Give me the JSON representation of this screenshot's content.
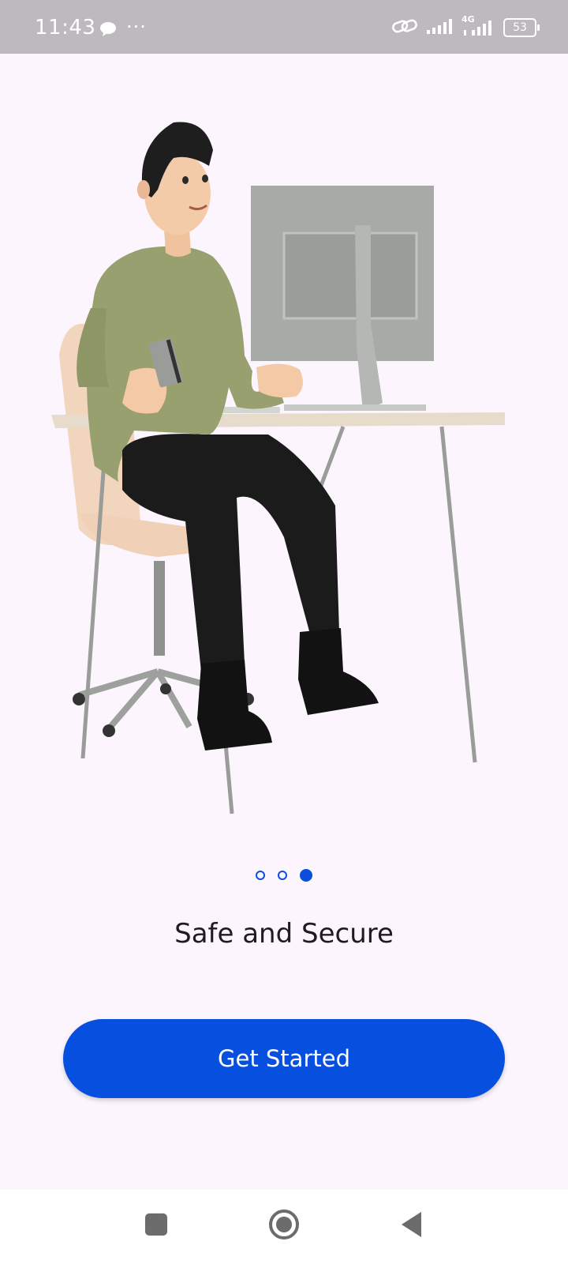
{
  "status_bar": {
    "time": "11:43",
    "more_dots": "···",
    "network": "4G",
    "battery": "53"
  },
  "onboarding": {
    "page_index": 3,
    "page_count": 3,
    "headline": "Safe and Secure",
    "cta_label": "Get Started"
  },
  "colors": {
    "accent": "#064fdf",
    "background": "#fcf5fd",
    "status_bar": "#bdb9be"
  },
  "icons": {
    "chat": "chat-bubble-icon",
    "link": "link-icon",
    "signal": "signal-icon",
    "recent": "square-icon",
    "home": "home-circle-icon",
    "back": "back-triangle-icon"
  }
}
